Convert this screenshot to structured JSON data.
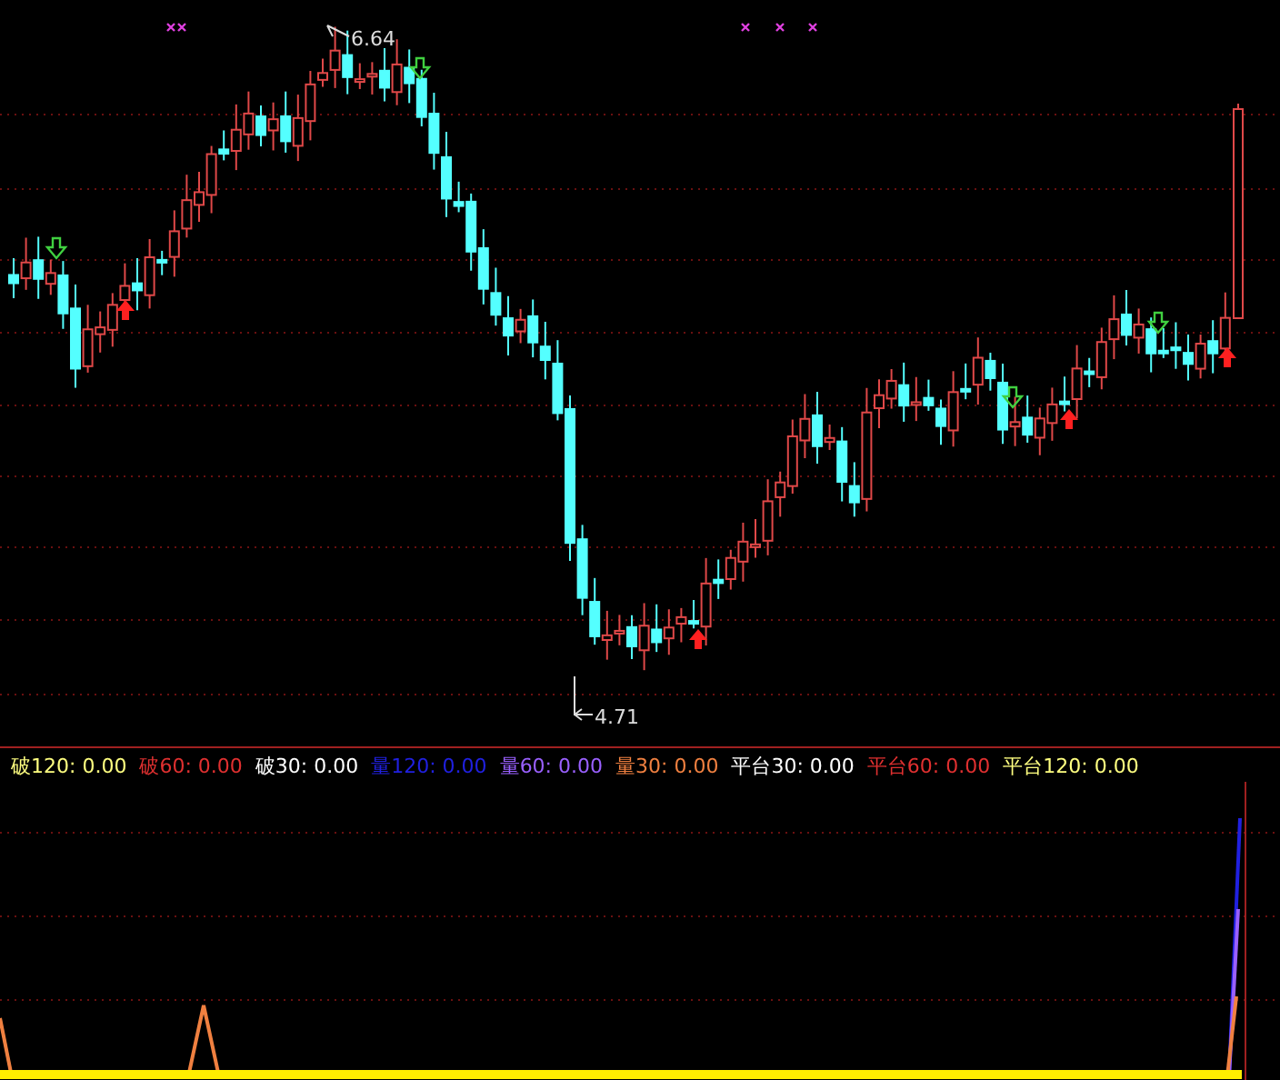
{
  "price_panel": {
    "high_label": "6.64",
    "low_label": "4.71"
  },
  "legend": [
    {
      "text": "破120: 0.00",
      "color": "#ffff80"
    },
    {
      "text": "破60: 0.00",
      "color": "#e03030"
    },
    {
      "text": "破30: 0.00",
      "color": "#ffffff"
    },
    {
      "text": "量120: 0.00",
      "color": "#2020e0"
    },
    {
      "text": "量60: 0.00",
      "color": "#9a60ff"
    },
    {
      "text": "量30: 0.00",
      "color": "#f08040"
    },
    {
      "text": "平台30: 0.00",
      "color": "#ffffff"
    },
    {
      "text": "平台60: 0.00",
      "color": "#e03030"
    },
    {
      "text": "平台120: 0.00",
      "color": "#ffff80"
    }
  ]
}
